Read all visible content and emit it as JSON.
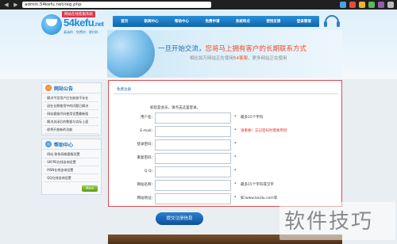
{
  "browser": {
    "url": "admin.54kefu.net/reg.php",
    "back": "◀",
    "forward": "▶"
  },
  "logo": {
    "tag": "网站在线客服系统",
    "brand": "54kefu",
    "tld": ".net",
    "slogan": "真诚的 · 免费的 · 便利的"
  },
  "topnav": [
    "首页",
    "新闻中心",
    "帮助中心",
    "免费申请",
    "系统特点",
    "使用反馈",
    "登录管理"
  ],
  "banner": {
    "line1_a": "一旦开始交流，",
    "line1_b": "您将马上拥有客户的长期联系方式",
    "line2_a": "相比如万网站正在使用",
    "line2_hl": "54客服",
    "line2_b": "，更多网站正在使用"
  },
  "sidebar": {
    "announce_title": "网站公告",
    "announce_items": [
      "解决平定用户后台缺加不存在",
      "因在长期使用中的问题已解决",
      "网站客服代码使用设置最新版",
      "解决关闭后的数据与实际上面",
      "即将开放新的功能"
    ],
    "help_title": "帮助中心",
    "help_items": [
      "网站 联系网络客服设置",
      "SKYPE在线咨询设置",
      "MSN在线咨询设置",
      "QQ在线咨询设置"
    ],
    "more_label": "More"
  },
  "form": {
    "tab": "免费注册",
    "note": "如您是会员，请点击这里登录。",
    "fields": [
      {
        "label": "用户名：",
        "hint": "最多15个字符",
        "hint_red": false
      },
      {
        "label": "E-mail：",
        "hint": "请重要！忘记密码时需要用到",
        "hint_red": true
      },
      {
        "label": "登录密码：",
        "hint": "",
        "hint_red": false
      },
      {
        "label": "重复密码：",
        "hint": "",
        "hint_red": false
      },
      {
        "label": "Q Q：",
        "hint": "",
        "hint_red": false
      },
      {
        "label": "网站名称：",
        "hint": "最多15个字符或汉字",
        "hint_red": false
      },
      {
        "label": "网站地址：",
        "hint": "如:www.baidu.com等",
        "hint_red": false
      }
    ],
    "star": "*",
    "submit_label": "提交注册信息"
  },
  "watermark": "软件技巧",
  "colors": {
    "nav_blue": "#0f65ad",
    "form_border": "#d94f4f",
    "hint_red": "#e3312b",
    "accent_orange": "#f04c2a"
  }
}
